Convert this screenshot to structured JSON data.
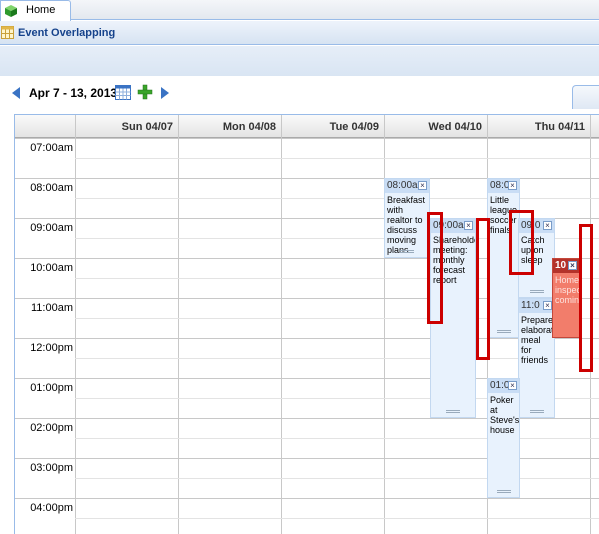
{
  "tab": {
    "label": "Home",
    "icon": "cube-icon"
  },
  "panel": {
    "title": "Event Overlapping",
    "icon": "calendar-grid-icon"
  },
  "nav": {
    "range": "Apr 7 - 13, 2013",
    "prev_icon": "arrow-left-icon",
    "next_icon": "arrow-right-icon",
    "calendar_icon": "calendar-icon",
    "add_icon": "add-icon"
  },
  "days": [
    "Sun 04/07",
    "Mon 04/08",
    "Tue 04/09",
    "Wed 04/10",
    "Thu 04/11"
  ],
  "times": [
    "07:00am",
    "08:00am",
    "09:00am",
    "10:00am",
    "11:00am",
    "12:00pm",
    "01:00pm",
    "02:00pm",
    "03:00pm",
    "04:00pm"
  ],
  "events": [
    {
      "time": "08:00am",
      "title": "Breakfast with realtor to discuss moving plans"
    },
    {
      "time": "09:00a",
      "title": "Shareholder meeting: monthly forecast report"
    },
    {
      "time": "08:0",
      "title": "Little league soccer finals"
    },
    {
      "time": "09:0",
      "title": "Catch up on sleep"
    },
    {
      "time": "11:0",
      "title": "Prepare elaborate meal for friends"
    },
    {
      "time": "01:0",
      "title": "Poker at Steve's house"
    },
    {
      "time": "10",
      "title": "Home inspection coming"
    }
  ],
  "colors": {
    "accent": "#3a73c4",
    "header_text": "#15428b",
    "event_bg": "#e8f2fd",
    "event_head": "#c9ddf5",
    "event_red": "#f27d6b",
    "highlight": "#cc0000"
  }
}
